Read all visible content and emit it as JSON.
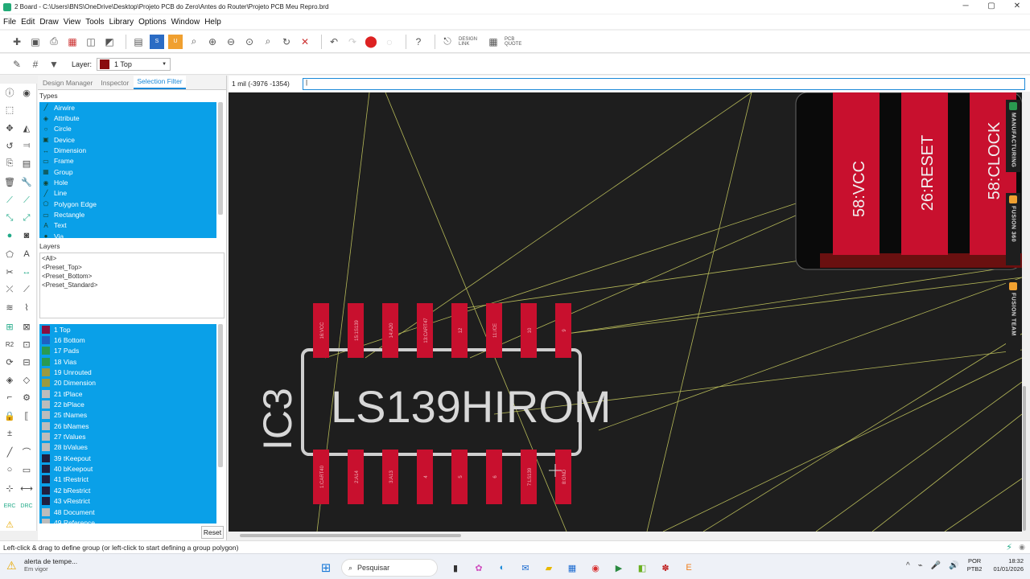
{
  "window": {
    "title": "2 Board - C:\\Users\\BNS\\OneDrive\\Desktop\\Projeto PCB do Zero\\Antes do Router\\Projeto PCB Meu Repro.brd",
    "controls": [
      "─",
      "▢",
      "✕"
    ]
  },
  "menu": [
    "File",
    "Edit",
    "Draw",
    "View",
    "Tools",
    "Library",
    "Options",
    "Window",
    "Help"
  ],
  "toolbar": {
    "design_link": "DESIGN LINK",
    "pcb_quote": "PCB QUOTE"
  },
  "layerbar": {
    "label": "Layer:",
    "selected": "1 Top",
    "selected_color": "#8a0d10"
  },
  "panel": {
    "tabs": [
      "Design Manager",
      "Inspector",
      "Selection Filter"
    ],
    "active_tab": 2,
    "types_label": "Types",
    "types": [
      "Airwire",
      "Attribute",
      "Circle",
      "Device",
      "Dimension",
      "Frame",
      "Group",
      "Hole",
      "Line",
      "Polygon Edge",
      "Rectangle",
      "Text",
      "Via"
    ],
    "layers_label": "Layers",
    "presets": [
      "<All>",
      "<Preset_Top>",
      "<Preset_Bottom>",
      "<Preset_Standard>"
    ],
    "layers": [
      {
        "name": "1 Top",
        "color": "#8a1040"
      },
      {
        "name": "16 Bottom",
        "color": "#2060c0"
      },
      {
        "name": "17 Pads",
        "color": "#2a9a50"
      },
      {
        "name": "18 Vias",
        "color": "#2a9a50"
      },
      {
        "name": "19 Unrouted",
        "color": "#9a9a40"
      },
      {
        "name": "20 Dimension",
        "color": "#9a9a40"
      },
      {
        "name": "21 tPlace",
        "color": "#bcbcbc"
      },
      {
        "name": "22 bPlace",
        "color": "#bcbcbc"
      },
      {
        "name": "25 tNames",
        "color": "#bcbcbc"
      },
      {
        "name": "26 bNames",
        "color": "#bcbcbc"
      },
      {
        "name": "27 tValues",
        "color": "#bcbcbc"
      },
      {
        "name": "28 bValues",
        "color": "#bcbcbc"
      },
      {
        "name": "39 tKeepout",
        "color": "#202040"
      },
      {
        "name": "40 bKeepout",
        "color": "#202040"
      },
      {
        "name": "41 tRestrict",
        "color": "#202040"
      },
      {
        "name": "42 bRestrict",
        "color": "#202040"
      },
      {
        "name": "43 vRestrict",
        "color": "#202040"
      },
      {
        "name": "48 Document",
        "color": "#bcbcbc"
      },
      {
        "name": "49 Reference",
        "color": "#bcbcbc"
      }
    ],
    "reset_label": "Reset"
  },
  "coord": "1 mil (-3976 -1354)",
  "command_value": "|",
  "board": {
    "chip_value": "LS139HIROM",
    "chip_name": "IC3",
    "top_pads": [
      "16:VCC",
      "15:1S139",
      "14:A20",
      "13:CART47",
      "12",
      "11:/CE",
      "10",
      "9"
    ],
    "bottom_pads": [
      "1:CART40",
      "2:A14",
      "3:A13",
      "4",
      "5",
      "6",
      "7:LS139",
      "8:GND"
    ],
    "connector_labels": [
      "58:VCC",
      "26:RESET",
      "58:CLOCK"
    ],
    "pad_color": "#c8102e"
  },
  "right_panels": [
    "MANUFACTURING",
    "FUSION 360",
    "FUSION TEAM"
  ],
  "status": "Left-click & drag to define group (or left-click to start defining a group polygon)",
  "taskbar": {
    "alert_title": "alerta de tempe...",
    "alert_sub": "Em vigor",
    "search": "Pesquisar",
    "lang1": "POR",
    "lang2": "PTB2",
    "time": "18:32",
    "date": "01/01/2026"
  }
}
